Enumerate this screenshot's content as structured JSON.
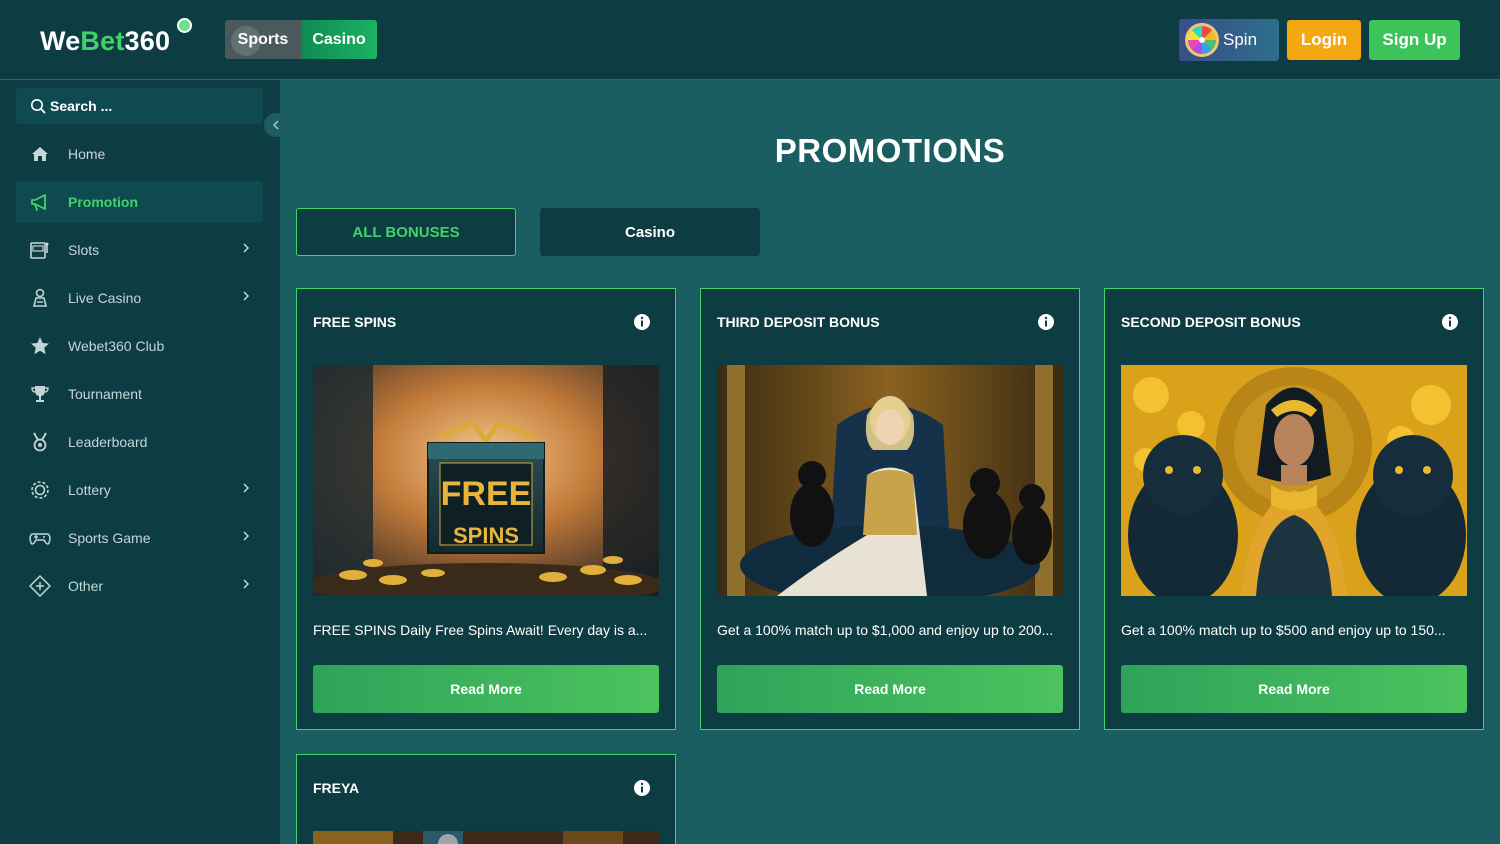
{
  "header": {
    "logo": {
      "we": "We",
      "bet": "Bet",
      "n360": "360"
    },
    "modes": {
      "sports": "Sports",
      "casino": "Casino"
    },
    "spin": "Spin",
    "login": "Login",
    "signup": "Sign Up"
  },
  "sidebar": {
    "search_placeholder": "Search ...",
    "items": [
      {
        "label": "Home",
        "icon": "home-icon",
        "active": false,
        "has_chevron": false
      },
      {
        "label": "Promotion",
        "icon": "megaphone-icon",
        "active": true,
        "has_chevron": false
      },
      {
        "label": "Slots",
        "icon": "slot-machine-icon",
        "active": false,
        "has_chevron": true
      },
      {
        "label": "Live Casino",
        "icon": "dealer-icon",
        "active": false,
        "has_chevron": true
      },
      {
        "label": "Webet360 Club",
        "icon": "star-icon",
        "active": false,
        "has_chevron": false
      },
      {
        "label": "Tournament",
        "icon": "trophy-icon",
        "active": false,
        "has_chevron": false
      },
      {
        "label": "Leaderboard",
        "icon": "medal-icon",
        "active": false,
        "has_chevron": false
      },
      {
        "label": "Lottery",
        "icon": "lottery-icon",
        "active": false,
        "has_chevron": true
      },
      {
        "label": "Sports Game",
        "icon": "gamepad-icon",
        "active": false,
        "has_chevron": true
      },
      {
        "label": "Other",
        "icon": "diamond-plus-icon",
        "active": false,
        "has_chevron": true
      }
    ]
  },
  "main": {
    "title": "PROMOTIONS",
    "tabs": [
      {
        "label": "ALL BONUSES",
        "active": true
      },
      {
        "label": "Casino",
        "active": false
      }
    ],
    "cards": [
      {
        "title": "FREE SPINS",
        "description": "FREE SPINS Daily Free Spins Await! Every day is a...",
        "button": "Read More",
        "image_text_top": "FREE",
        "image_text_bottom": "SPINS"
      },
      {
        "title": "THIRD DEPOSIT BONUS",
        "description": "Get a 100% match up to $1,000 and enjoy up to 200...",
        "button": "Read More"
      },
      {
        "title": "SECOND DEPOSIT BONUS",
        "description": "Get a 100% match up to $500 and enjoy up to 150...",
        "button": "Read More"
      },
      {
        "title": "FREYA",
        "description": "",
        "button": ""
      }
    ]
  },
  "colors": {
    "background": "#1a5e62",
    "panel": "#0d3d43",
    "accent_green": "#3fd36a",
    "login_orange": "#f5a70f",
    "signup_green": "#3cc35a"
  }
}
